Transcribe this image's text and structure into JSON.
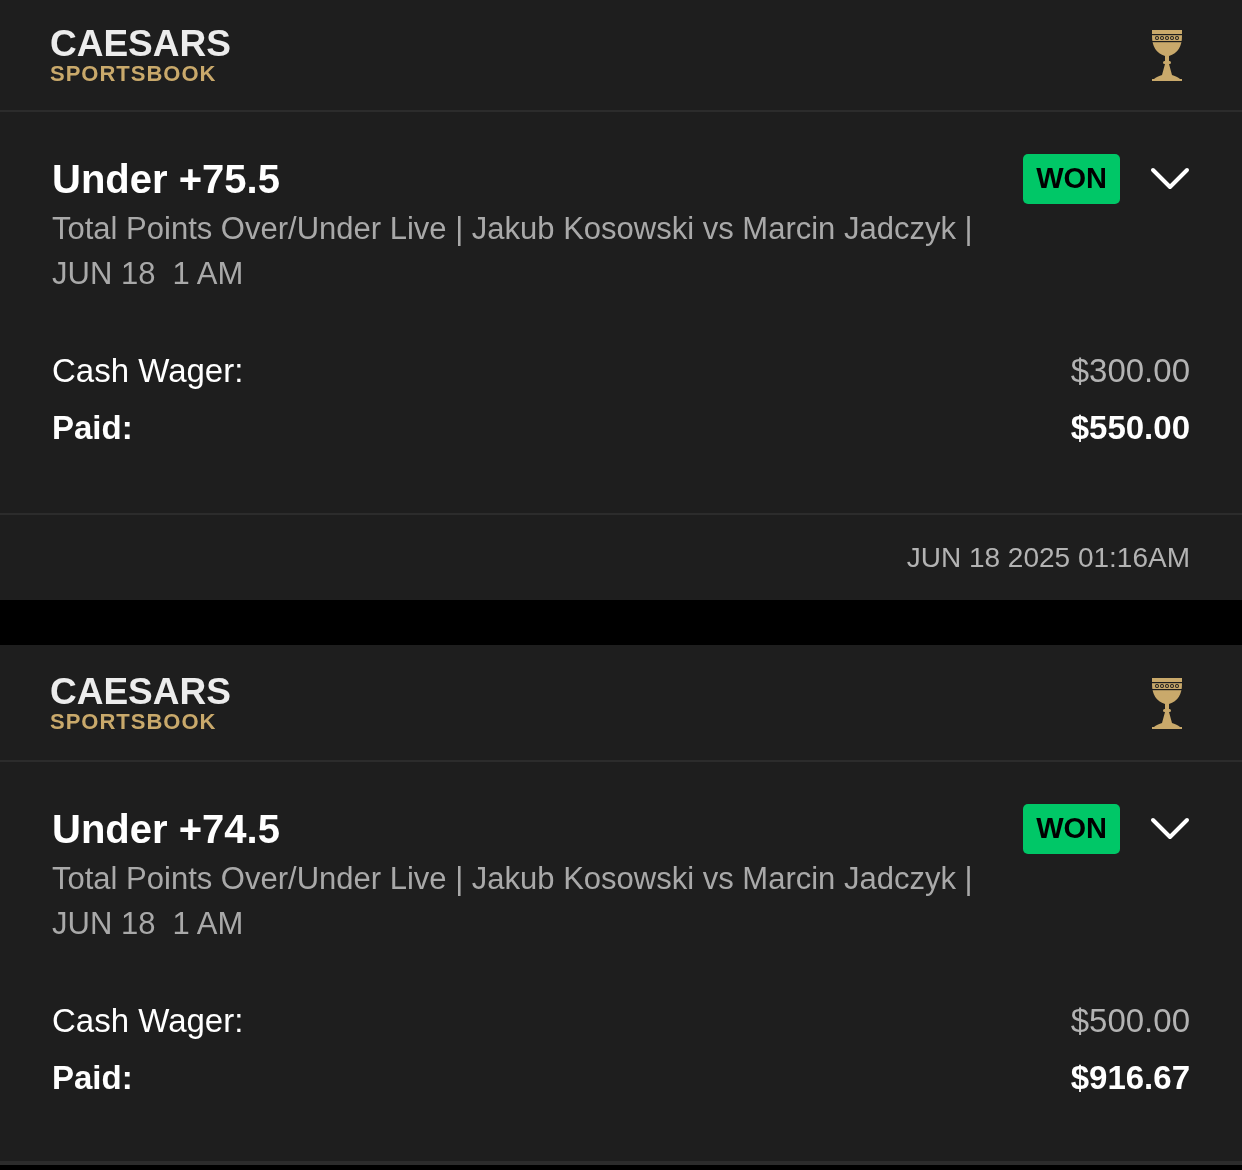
{
  "bets": [
    {
      "logo": {
        "brand": "CAESARS",
        "sub": "SPORTSBOOK"
      },
      "title": "Under +75.5",
      "status": "WON",
      "expanded": false,
      "description": "Total Points Over/Under Live | Jakub Kosowski vs Marcin Jadczyk | JUN 18  1 AM",
      "wager_label": "Cash Wager:",
      "wager": "$300.00",
      "paid_label": "Paid:",
      "paid": "$550.00",
      "timestamp": "JUN 18 2025 01:16AM"
    },
    {
      "logo": {
        "brand": "CAESARS",
        "sub": "SPORTSBOOK"
      },
      "title": "Under +74.5",
      "status": "WON",
      "expanded": false,
      "description": "Total Points Over/Under Live | Jakub Kosowski vs Marcin Jadczyk | JUN 18  1 AM",
      "wager_label": "Cash Wager:",
      "wager": "$500.00",
      "paid_label": "Paid:",
      "paid": "$916.67"
    }
  ]
}
